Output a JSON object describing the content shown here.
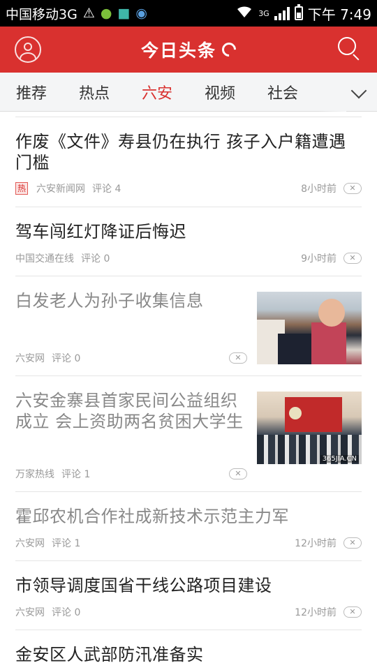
{
  "status_bar": {
    "carrier": "中国移动3G",
    "network": "3G",
    "time": "下午 7:49"
  },
  "header": {
    "title": "今日头条"
  },
  "tabs": [
    {
      "label": "推荐",
      "active": false
    },
    {
      "label": "热点",
      "active": false
    },
    {
      "label": "六安",
      "active": true
    },
    {
      "label": "视频",
      "active": false
    },
    {
      "label": "社会",
      "active": false
    }
  ],
  "feed": [
    {
      "title": "作废《文件》寿县仍在执行 孩子入户籍遭遇门槛",
      "hot": "热",
      "source": "六安新闻网",
      "comments": "评论 4",
      "time": "8小时前",
      "read": false
    },
    {
      "title": "驾车闯红灯降证后悔迟",
      "source": "中国交通在线",
      "comments": "评论 0",
      "time": "9小时前",
      "read": false
    },
    {
      "title": "白发老人为孙子收集信息",
      "source": "六安网",
      "comments": "评论 0",
      "time": "",
      "read": true,
      "image": "photo-elderly-man-crowd"
    },
    {
      "title": "六安金寨县首家民间公益组织成立 会上资助两名贫困大学生",
      "source": "万家热线",
      "comments": "评论 1",
      "time": "",
      "read": true,
      "image": "photo-conference-hall",
      "image_watermark": "365JIA.CN"
    },
    {
      "title": "霍邱农机合作社成新技术示范主力军",
      "source": "六安网",
      "comments": "评论 1",
      "time": "12小时前",
      "read": true
    },
    {
      "title": "市领导调度国省干线公路项目建设",
      "source": "六安网",
      "comments": "评论 0",
      "time": "12小时前",
      "read": false
    },
    {
      "title": "金安区人武部防汛准备实",
      "read": false
    }
  ],
  "dislike_label": "✕"
}
